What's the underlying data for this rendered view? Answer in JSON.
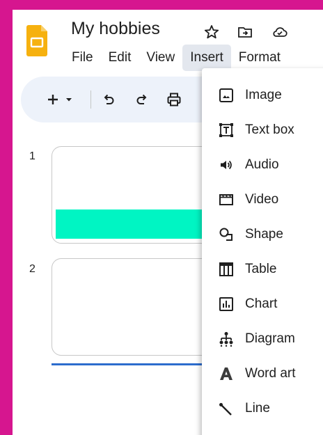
{
  "document": {
    "title": "My hobbies"
  },
  "menu": [
    "File",
    "Edit",
    "View",
    "Insert",
    "Format"
  ],
  "slides": [
    {
      "number": "1"
    },
    {
      "number": "2"
    }
  ],
  "insert_menu": [
    {
      "label": "Image",
      "icon": "image-icon"
    },
    {
      "label": "Text box",
      "icon": "text-box-icon"
    },
    {
      "label": "Audio",
      "icon": "audio-icon"
    },
    {
      "label": "Video",
      "icon": "video-icon"
    },
    {
      "label": "Shape",
      "icon": "shape-icon"
    },
    {
      "label": "Table",
      "icon": "table-icon"
    },
    {
      "label": "Chart",
      "icon": "chart-icon"
    },
    {
      "label": "Diagram",
      "icon": "diagram-icon"
    },
    {
      "label": "Word art",
      "icon": "word-art-icon"
    },
    {
      "label": "Line",
      "icon": "line-icon"
    }
  ],
  "colors": {
    "border": "#d6168f",
    "slides_logo": "#f6b10f",
    "toolbar_bg": "#edf2fa",
    "slide_band": "#00f5c3",
    "selection_line": "#2c6ccd"
  }
}
